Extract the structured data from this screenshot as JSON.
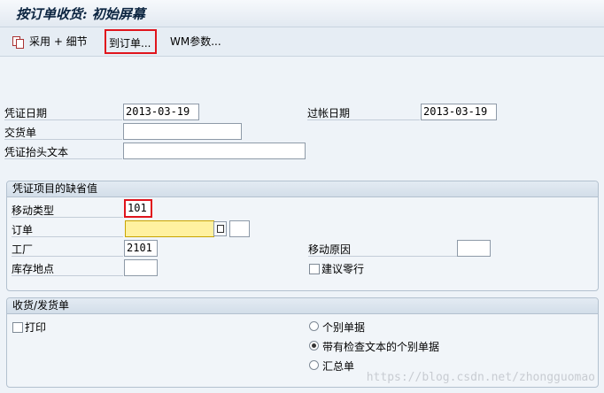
{
  "window": {
    "title": "按订单收货: 初始屏幕"
  },
  "toolbar": {
    "adopt_label": "采用 + 细节",
    "order_label": "到订单...",
    "wm_label": "WM参数..."
  },
  "doc": {
    "doc_date_label": "凭证日期",
    "doc_date_value": "2013-03-19",
    "posting_date_label": "过帐日期",
    "posting_date_value": "2013-03-19",
    "delivery_note_label": "交货单",
    "delivery_note_value": "",
    "header_text_label": "凭证抬头文本",
    "header_text_value": ""
  },
  "defaults": {
    "title": "凭证项目的缺省值",
    "movement_type_label": "移动类型",
    "movement_type_value": "101",
    "order_label": "订单",
    "order_value": "",
    "plant_label": "工厂",
    "plant_value": "2101",
    "storage_loc_label": "库存地点",
    "storage_loc_value": "",
    "reason_label": "移动原因",
    "reason_value": "",
    "suggest_zero_label": "建议零行"
  },
  "grslip": {
    "title": "收货/发货单",
    "print_label": "打印",
    "option_individual": "个别单据",
    "option_individual_text": "带有检查文本的个别单据",
    "option_collective": "汇总单",
    "selected": "option_individual_text"
  },
  "watermark": "https://blog.csdn.net/zhongguomao"
}
